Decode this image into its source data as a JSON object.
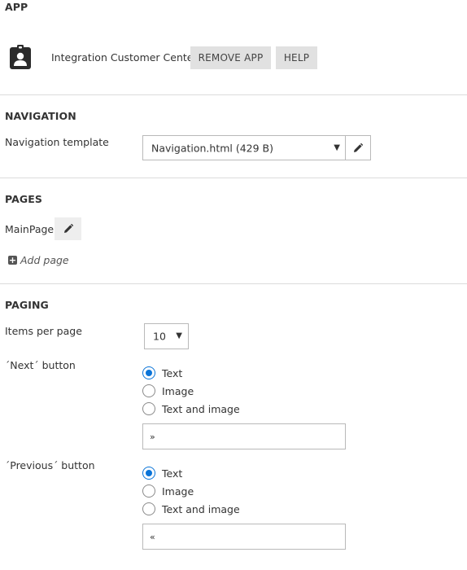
{
  "app": {
    "section_title": "APP",
    "app_name": "Integration Customer Center",
    "remove_label": "REMOVE APP",
    "help_label": "HELP",
    "icon": "contact-badge-icon"
  },
  "navigation": {
    "section_title": "NAVIGATION",
    "template_label": "Navigation template",
    "template_value": "Navigation.html (429 B)",
    "edit_icon": "pencil-icon"
  },
  "pages": {
    "section_title": "PAGES",
    "items": [
      {
        "label": "MainPage"
      }
    ],
    "add_label": "Add page"
  },
  "paging": {
    "section_title": "PAGING",
    "items_per_page_label": "Items per page",
    "items_per_page_value": "10",
    "next": {
      "label": "´Next´ button",
      "options": [
        "Text",
        "Image",
        "Text and image"
      ],
      "selected": "Text",
      "text_value": "»"
    },
    "previous": {
      "label": "´Previous´ button",
      "options": [
        "Text",
        "Image",
        "Text and image"
      ],
      "selected": "Text",
      "text_value": "«"
    }
  },
  "colors": {
    "accent": "#0a74d8",
    "button_bg": "#e1e1e1",
    "divider": "#dcdcdc"
  }
}
